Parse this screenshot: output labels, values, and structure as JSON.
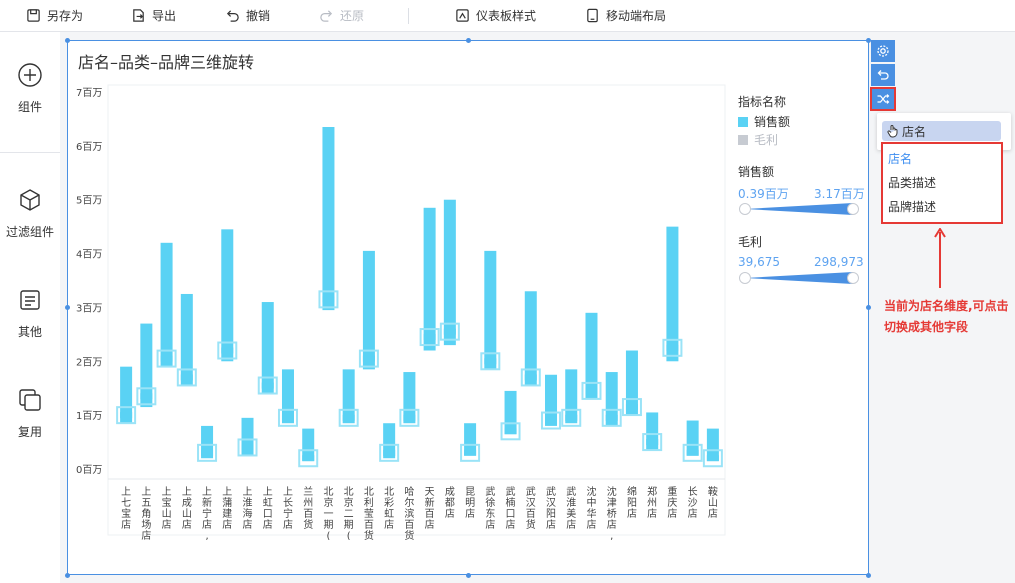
{
  "toolbar": {
    "save_as": "另存为",
    "export": "导出",
    "undo": "撤销",
    "redo": "还原",
    "dashboard_style": "仪表板样式",
    "mobile_layout": "移动端布局"
  },
  "sidebar": {
    "components": "组件",
    "filter_components": "过滤组件",
    "other": "其他",
    "reuse": "复用"
  },
  "widget": {
    "title": "店名–品类–品牌三维旋转"
  },
  "legend": {
    "indicator_title": "指标名称",
    "sales": "销售额",
    "profit": "毛利",
    "sales_range_title": "销售额",
    "sales_min": "0.39百万",
    "sales_max": "3.17百万",
    "profit_range_title": "毛利",
    "profit_min": "39,675",
    "profit_max": "298,973"
  },
  "popup": {
    "current_field": "店名",
    "options": [
      "店名",
      "品类描述",
      "品牌描述"
    ]
  },
  "annotation": {
    "text": "当前为店名维度,可点击切换成其他字段"
  },
  "colors": {
    "accent": "#4a90e2",
    "bar": "#5ad2f4",
    "marker": "#9ae3f7",
    "highlight_red": "#e53935",
    "profit_legend": "#c7cbd2"
  },
  "chart_data": {
    "type": "bar",
    "yticks": [
      "0百万",
      "1百万",
      "2百万",
      "3百万",
      "4百万",
      "5百万",
      "6百万",
      "7百万"
    ],
    "ylim": [
      0,
      7
    ],
    "unit": "百万",
    "categories": [
      "上七宝店",
      "上五角场店",
      "上宝山店",
      "上成山店",
      "上新宁店,",
      "上蒲建店",
      "上淮海店",
      "上虹口店",
      "上长宁店",
      "兰州百货",
      "北京一期(百货)",
      "北京二期(百货)",
      "北利莹百货",
      "北彩虹店",
      "哈尔滨百货",
      "天新百店",
      "成都店",
      "昆明店",
      "武徐东店",
      "武楠口店",
      "武汉百货",
      "武汉阳店",
      "武淮美店",
      "沈中华店",
      "沈津桥店,",
      "绵阳店",
      "郑州店",
      "重庆店",
      "长沙店",
      "鞍山店"
    ],
    "series": [
      {
        "name": "销售额",
        "low": [
          0.85,
          1.15,
          1.9,
          1.55,
          0.2,
          2.0,
          0.25,
          1.4,
          0.85,
          0.15,
          2.95,
          0.85,
          1.85,
          0.2,
          0.85,
          2.2,
          2.3,
          0.25,
          1.85,
          0.65,
          1.55,
          0.8,
          0.85,
          1.3,
          0.8,
          1.0,
          0.35,
          2.0,
          0.25,
          0.15
        ],
        "high": [
          1.9,
          2.7,
          4.2,
          3.25,
          0.8,
          4.45,
          0.95,
          3.1,
          1.85,
          0.75,
          6.35,
          1.85,
          4.05,
          0.85,
          1.8,
          4.85,
          5.0,
          0.85,
          4.05,
          1.45,
          3.3,
          1.75,
          1.85,
          2.9,
          1.8,
          2.2,
          1.05,
          4.5,
          0.9,
          0.75
        ]
      },
      {
        "name": "毛利",
        "values": [
          1.0,
          1.35,
          2.05,
          1.7,
          0.3,
          2.2,
          0.4,
          1.55,
          0.95,
          0.2,
          3.15,
          0.95,
          2.05,
          0.3,
          0.95,
          2.45,
          2.55,
          0.3,
          2.0,
          0.7,
          1.7,
          0.9,
          0.95,
          1.45,
          0.95,
          1.15,
          0.5,
          2.25,
          0.3,
          0.2
        ]
      }
    ],
    "legend_position": "right"
  }
}
